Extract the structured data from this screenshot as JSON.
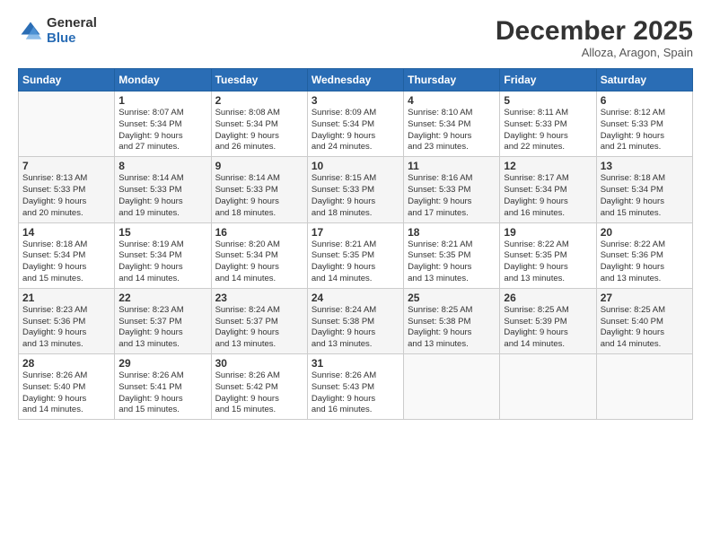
{
  "logo": {
    "general": "General",
    "blue": "Blue"
  },
  "header": {
    "month": "December 2025",
    "location": "Alloza, Aragon, Spain"
  },
  "weekdays": [
    "Sunday",
    "Monday",
    "Tuesday",
    "Wednesday",
    "Thursday",
    "Friday",
    "Saturday"
  ],
  "weeks": [
    [
      {
        "day": "",
        "info": ""
      },
      {
        "day": "1",
        "info": "Sunrise: 8:07 AM\nSunset: 5:34 PM\nDaylight: 9 hours\nand 27 minutes."
      },
      {
        "day": "2",
        "info": "Sunrise: 8:08 AM\nSunset: 5:34 PM\nDaylight: 9 hours\nand 26 minutes."
      },
      {
        "day": "3",
        "info": "Sunrise: 8:09 AM\nSunset: 5:34 PM\nDaylight: 9 hours\nand 24 minutes."
      },
      {
        "day": "4",
        "info": "Sunrise: 8:10 AM\nSunset: 5:34 PM\nDaylight: 9 hours\nand 23 minutes."
      },
      {
        "day": "5",
        "info": "Sunrise: 8:11 AM\nSunset: 5:33 PM\nDaylight: 9 hours\nand 22 minutes."
      },
      {
        "day": "6",
        "info": "Sunrise: 8:12 AM\nSunset: 5:33 PM\nDaylight: 9 hours\nand 21 minutes."
      }
    ],
    [
      {
        "day": "7",
        "info": "Sunrise: 8:13 AM\nSunset: 5:33 PM\nDaylight: 9 hours\nand 20 minutes."
      },
      {
        "day": "8",
        "info": "Sunrise: 8:14 AM\nSunset: 5:33 PM\nDaylight: 9 hours\nand 19 minutes."
      },
      {
        "day": "9",
        "info": "Sunrise: 8:14 AM\nSunset: 5:33 PM\nDaylight: 9 hours\nand 18 minutes."
      },
      {
        "day": "10",
        "info": "Sunrise: 8:15 AM\nSunset: 5:33 PM\nDaylight: 9 hours\nand 18 minutes."
      },
      {
        "day": "11",
        "info": "Sunrise: 8:16 AM\nSunset: 5:33 PM\nDaylight: 9 hours\nand 17 minutes."
      },
      {
        "day": "12",
        "info": "Sunrise: 8:17 AM\nSunset: 5:34 PM\nDaylight: 9 hours\nand 16 minutes."
      },
      {
        "day": "13",
        "info": "Sunrise: 8:18 AM\nSunset: 5:34 PM\nDaylight: 9 hours\nand 15 minutes."
      }
    ],
    [
      {
        "day": "14",
        "info": "Sunrise: 8:18 AM\nSunset: 5:34 PM\nDaylight: 9 hours\nand 15 minutes."
      },
      {
        "day": "15",
        "info": "Sunrise: 8:19 AM\nSunset: 5:34 PM\nDaylight: 9 hours\nand 14 minutes."
      },
      {
        "day": "16",
        "info": "Sunrise: 8:20 AM\nSunset: 5:34 PM\nDaylight: 9 hours\nand 14 minutes."
      },
      {
        "day": "17",
        "info": "Sunrise: 8:21 AM\nSunset: 5:35 PM\nDaylight: 9 hours\nand 14 minutes."
      },
      {
        "day": "18",
        "info": "Sunrise: 8:21 AM\nSunset: 5:35 PM\nDaylight: 9 hours\nand 13 minutes."
      },
      {
        "day": "19",
        "info": "Sunrise: 8:22 AM\nSunset: 5:35 PM\nDaylight: 9 hours\nand 13 minutes."
      },
      {
        "day": "20",
        "info": "Sunrise: 8:22 AM\nSunset: 5:36 PM\nDaylight: 9 hours\nand 13 minutes."
      }
    ],
    [
      {
        "day": "21",
        "info": "Sunrise: 8:23 AM\nSunset: 5:36 PM\nDaylight: 9 hours\nand 13 minutes."
      },
      {
        "day": "22",
        "info": "Sunrise: 8:23 AM\nSunset: 5:37 PM\nDaylight: 9 hours\nand 13 minutes."
      },
      {
        "day": "23",
        "info": "Sunrise: 8:24 AM\nSunset: 5:37 PM\nDaylight: 9 hours\nand 13 minutes."
      },
      {
        "day": "24",
        "info": "Sunrise: 8:24 AM\nSunset: 5:38 PM\nDaylight: 9 hours\nand 13 minutes."
      },
      {
        "day": "25",
        "info": "Sunrise: 8:25 AM\nSunset: 5:38 PM\nDaylight: 9 hours\nand 13 minutes."
      },
      {
        "day": "26",
        "info": "Sunrise: 8:25 AM\nSunset: 5:39 PM\nDaylight: 9 hours\nand 14 minutes."
      },
      {
        "day": "27",
        "info": "Sunrise: 8:25 AM\nSunset: 5:40 PM\nDaylight: 9 hours\nand 14 minutes."
      }
    ],
    [
      {
        "day": "28",
        "info": "Sunrise: 8:26 AM\nSunset: 5:40 PM\nDaylight: 9 hours\nand 14 minutes."
      },
      {
        "day": "29",
        "info": "Sunrise: 8:26 AM\nSunset: 5:41 PM\nDaylight: 9 hours\nand 15 minutes."
      },
      {
        "day": "30",
        "info": "Sunrise: 8:26 AM\nSunset: 5:42 PM\nDaylight: 9 hours\nand 15 minutes."
      },
      {
        "day": "31",
        "info": "Sunrise: 8:26 AM\nSunset: 5:43 PM\nDaylight: 9 hours\nand 16 minutes."
      },
      {
        "day": "",
        "info": ""
      },
      {
        "day": "",
        "info": ""
      },
      {
        "day": "",
        "info": ""
      }
    ]
  ]
}
